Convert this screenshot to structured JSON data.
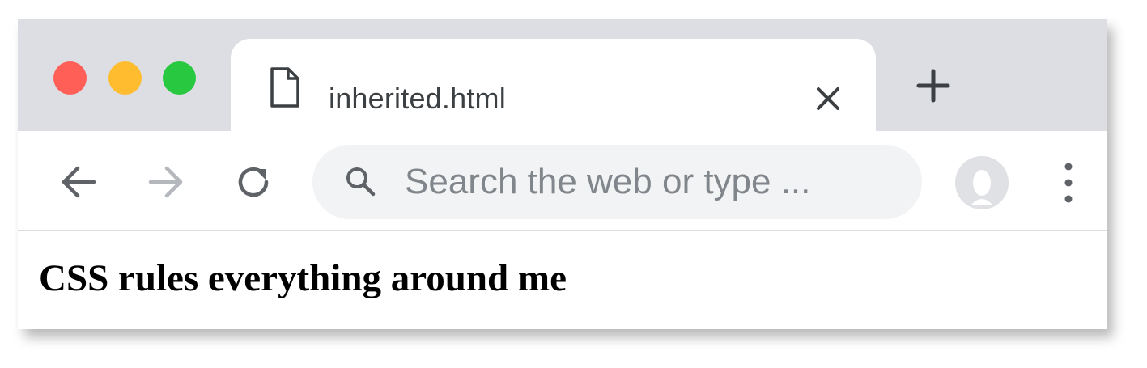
{
  "window": {
    "traffic_lights": {
      "close_color": "#ff5f57",
      "minimize_color": "#febc2e",
      "maximize_color": "#28c840"
    }
  },
  "tabs": [
    {
      "title": "inherited.html",
      "icon": "file-icon",
      "active": true
    }
  ],
  "toolbar": {
    "back_icon": "arrow-left-icon",
    "forward_icon": "arrow-right-icon",
    "reload_icon": "reload-icon",
    "search": {
      "placeholder": "Search the web or type ...",
      "value": "",
      "icon": "search-icon"
    },
    "profile_icon": "avatar",
    "menu_icon": "kebab-menu-icon"
  },
  "page": {
    "heading": "CSS rules everything around me"
  }
}
